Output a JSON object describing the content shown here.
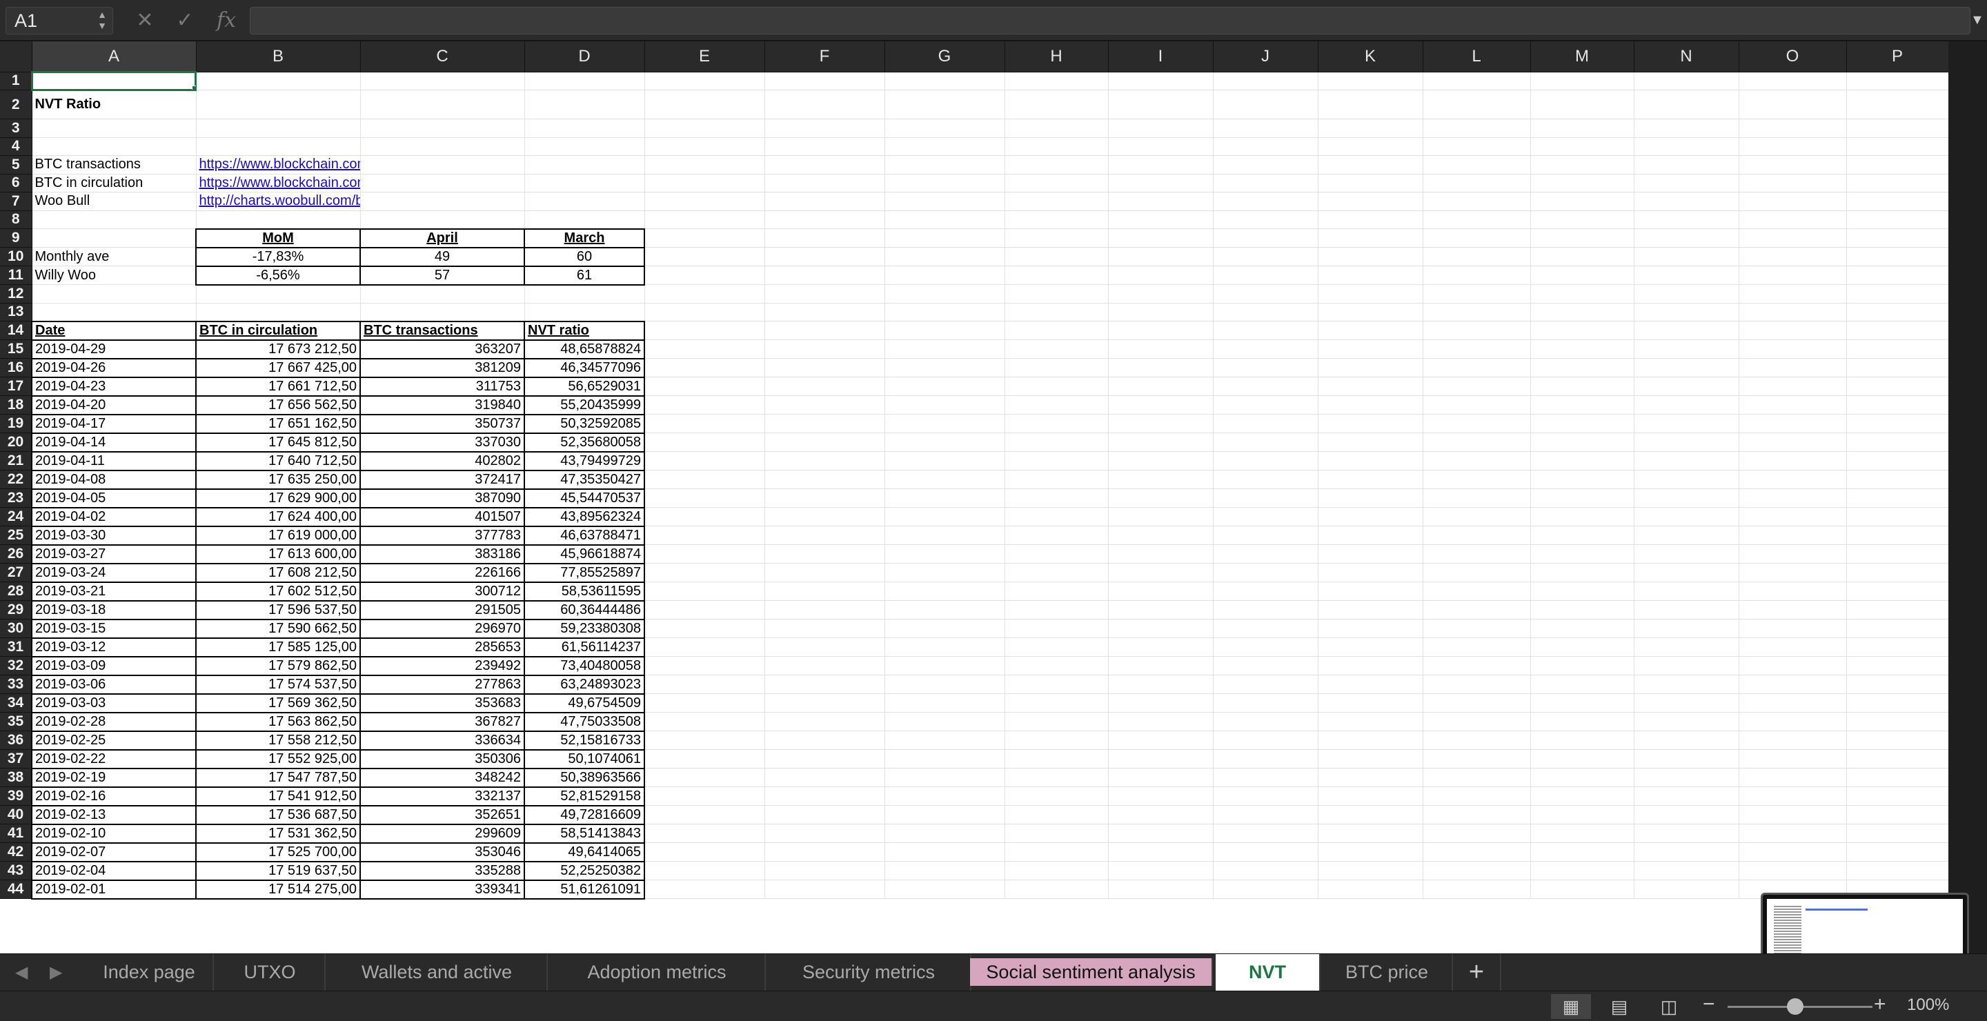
{
  "formula_bar": {
    "name_box": "A1",
    "formula": ""
  },
  "columns": [
    "A",
    "B",
    "C",
    "D",
    "E",
    "F",
    "G",
    "H",
    "I",
    "J",
    "K",
    "L",
    "M",
    "N",
    "O",
    "P"
  ],
  "sheet": {
    "title": "NVT Ratio",
    "sources": [
      {
        "row": 5,
        "label": "BTC transactions",
        "url": "https://www.blockchain.com/charts/n-transactions?timespan=all"
      },
      {
        "row": 6,
        "label": "BTC in circulation",
        "url": "https://www.blockchain.com/charts/total-bitcoins?timespan=all"
      },
      {
        "row": 7,
        "label": "Woo Bull",
        "url": "http://charts.woobull.com/bitcoin-nvt-ratio/"
      }
    ],
    "summary_headers": [
      "MoM",
      "April",
      "March"
    ],
    "summary_rows": [
      {
        "label": "Monthly ave",
        "values": [
          "-17,83%",
          "49",
          "60"
        ]
      },
      {
        "label": "Willy Woo",
        "values": [
          "-6,56%",
          "57",
          "61"
        ]
      }
    ],
    "data_headers": [
      "Date",
      "BTC in circulation",
      "BTC transactions",
      "NVT ratio"
    ],
    "data_rows": [
      [
        "2019-04-29",
        "17 673 212,50",
        "363207",
        "48,65878824"
      ],
      [
        "2019-04-26",
        "17 667 425,00",
        "381209",
        "46,34577096"
      ],
      [
        "2019-04-23",
        "17 661 712,50",
        "311753",
        "56,6529031"
      ],
      [
        "2019-04-20",
        "17 656 562,50",
        "319840",
        "55,20435999"
      ],
      [
        "2019-04-17",
        "17 651 162,50",
        "350737",
        "50,32592085"
      ],
      [
        "2019-04-14",
        "17 645 812,50",
        "337030",
        "52,35680058"
      ],
      [
        "2019-04-11",
        "17 640 712,50",
        "402802",
        "43,79499729"
      ],
      [
        "2019-04-08",
        "17 635 250,00",
        "372417",
        "47,35350427"
      ],
      [
        "2019-04-05",
        "17 629 900,00",
        "387090",
        "45,54470537"
      ],
      [
        "2019-04-02",
        "17 624 400,00",
        "401507",
        "43,89562324"
      ],
      [
        "2019-03-30",
        "17 619 000,00",
        "377783",
        "46,63788471"
      ],
      [
        "2019-03-27",
        "17 613 600,00",
        "383186",
        "45,96618874"
      ],
      [
        "2019-03-24",
        "17 608 212,50",
        "226166",
        "77,85525897"
      ],
      [
        "2019-03-21",
        "17 602 512,50",
        "300712",
        "58,53611595"
      ],
      [
        "2019-03-18",
        "17 596 537,50",
        "291505",
        "60,36444486"
      ],
      [
        "2019-03-15",
        "17 590 662,50",
        "296970",
        "59,23380308"
      ],
      [
        "2019-03-12",
        "17 585 125,00",
        "285653",
        "61,56114237"
      ],
      [
        "2019-03-09",
        "17 579 862,50",
        "239492",
        "73,40480058"
      ],
      [
        "2019-03-06",
        "17 574 537,50",
        "277863",
        "63,24893023"
      ],
      [
        "2019-03-03",
        "17 569 362,50",
        "353683",
        "49,6754509"
      ],
      [
        "2019-02-28",
        "17 563 862,50",
        "367827",
        "47,75033508"
      ],
      [
        "2019-02-25",
        "17 558 212,50",
        "336634",
        "52,15816733"
      ],
      [
        "2019-02-22",
        "17 552 925,00",
        "350306",
        "50,1074061"
      ],
      [
        "2019-02-19",
        "17 547 787,50",
        "348242",
        "50,38963566"
      ],
      [
        "2019-02-16",
        "17 541 912,50",
        "332137",
        "52,81529158"
      ],
      [
        "2019-02-13",
        "17 536 687,50",
        "352651",
        "49,72816609"
      ],
      [
        "2019-02-10",
        "17 531 362,50",
        "299609",
        "58,51413843"
      ],
      [
        "2019-02-07",
        "17 525 700,00",
        "353046",
        "49,6414065"
      ],
      [
        "2019-02-04",
        "17 519 637,50",
        "335288",
        "52,25250382"
      ],
      [
        "2019-02-01",
        "17 514 275,00",
        "339341",
        "51,61261091"
      ]
    ]
  },
  "tabs": [
    {
      "label": "Index page",
      "state": "normal"
    },
    {
      "label": "UTXO",
      "state": "normal"
    },
    {
      "label": "Wallets and active addresses",
      "state": "normal"
    },
    {
      "label": "Adoption metrics",
      "state": "normal"
    },
    {
      "label": "Security metrics",
      "state": "normal"
    },
    {
      "label": "Social sentiment analysis",
      "state": "pink"
    },
    {
      "label": "NVT",
      "state": "active"
    },
    {
      "label": "BTC price",
      "state": "normal"
    }
  ],
  "add_tab": "+",
  "status": {
    "zoom": "100%"
  }
}
